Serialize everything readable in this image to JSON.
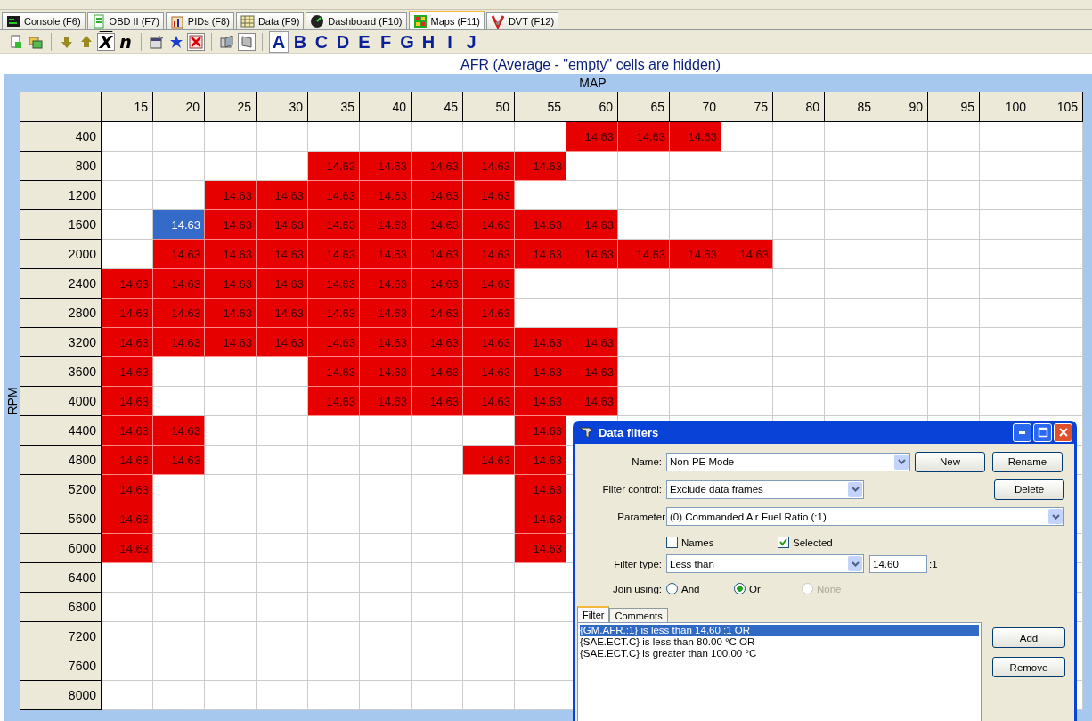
{
  "tabs": [
    {
      "label": "Console (F6)",
      "selected": false
    },
    {
      "label": "OBD II (F7)",
      "selected": false
    },
    {
      "label": "PIDs (F8)",
      "selected": false
    },
    {
      "label": "Data (F9)",
      "selected": false
    },
    {
      "label": "Dashboard (F10)",
      "selected": false
    },
    {
      "label": "Maps (F11)",
      "selected": true
    },
    {
      "label": "DVT (F12)",
      "selected": false
    }
  ],
  "toolbar": {
    "glyph_buttons": [
      {
        "label": "X",
        "pressed": true
      },
      {
        "label": "n",
        "pressed": false
      }
    ],
    "letters": [
      {
        "label": "A",
        "selected": true
      },
      {
        "label": "B",
        "selected": false
      },
      {
        "label": "C",
        "selected": false
      },
      {
        "label": "D",
        "selected": false
      },
      {
        "label": "E",
        "selected": false
      },
      {
        "label": "F",
        "selected": false
      },
      {
        "label": "G",
        "selected": false
      },
      {
        "label": "H",
        "selected": false
      },
      {
        "label": "I",
        "selected": false
      },
      {
        "label": "J",
        "selected": false
      }
    ]
  },
  "map": {
    "title": "AFR (Average - \"empty\" cells are hidden)",
    "x_axis": "MAP",
    "y_axis": "RPM",
    "columns": [
      "15",
      "20",
      "25",
      "30",
      "35",
      "40",
      "45",
      "50",
      "55",
      "60",
      "65",
      "70",
      "75",
      "80",
      "85",
      "90",
      "95",
      "100",
      "105"
    ],
    "rows": [
      {
        "label": "400",
        "cells": [
          null,
          null,
          null,
          null,
          null,
          null,
          null,
          null,
          null,
          {
            "value": "14.63",
            "selected": false
          },
          {
            "value": "14.63",
            "selected": false
          },
          {
            "value": "14.63",
            "selected": false
          }
        ]
      },
      {
        "label": "800",
        "cells": [
          null,
          null,
          null,
          null,
          {
            "value": "14.63",
            "selected": false
          },
          {
            "value": "14.63",
            "selected": false
          },
          {
            "value": "14.63",
            "selected": false
          },
          {
            "value": "14.63",
            "selected": false
          },
          {
            "value": "14.63",
            "selected": false
          }
        ]
      },
      {
        "label": "1200",
        "cells": [
          null,
          null,
          {
            "value": "14.63",
            "selected": false
          },
          {
            "value": "14.63",
            "selected": false
          },
          {
            "value": "14.63",
            "selected": false
          },
          {
            "value": "14.63",
            "selected": false
          },
          {
            "value": "14.63",
            "selected": false
          },
          {
            "value": "14.63",
            "selected": false
          }
        ]
      },
      {
        "label": "1600",
        "cells": [
          null,
          {
            "value": "14.63",
            "selected": true
          },
          {
            "value": "14.63",
            "selected": false
          },
          {
            "value": "14.63",
            "selected": false
          },
          {
            "value": "14.63",
            "selected": false
          },
          {
            "value": "14.63",
            "selected": false
          },
          {
            "value": "14.63",
            "selected": false
          },
          {
            "value": "14.63",
            "selected": false
          },
          {
            "value": "14.63",
            "selected": false
          },
          {
            "value": "14.63",
            "selected": false
          }
        ]
      },
      {
        "label": "2000",
        "cells": [
          null,
          {
            "value": "14.63",
            "selected": false
          },
          {
            "value": "14.63",
            "selected": false
          },
          {
            "value": "14.63",
            "selected": false
          },
          {
            "value": "14.63",
            "selected": false
          },
          {
            "value": "14.63",
            "selected": false
          },
          {
            "value": "14.63",
            "selected": false
          },
          {
            "value": "14.63",
            "selected": false
          },
          {
            "value": "14.63",
            "selected": false
          },
          {
            "value": "14.63",
            "selected": false
          },
          {
            "value": "14.63",
            "selected": false
          },
          {
            "value": "14.63",
            "selected": false
          },
          {
            "value": "14.63",
            "selected": false
          }
        ]
      },
      {
        "label": "2400",
        "cells": [
          {
            "value": "14.63",
            "selected": false
          },
          {
            "value": "14.63",
            "selected": false
          },
          {
            "value": "14.63",
            "selected": false
          },
          {
            "value": "14.63",
            "selected": false
          },
          {
            "value": "14.63",
            "selected": false
          },
          {
            "value": "14.63",
            "selected": false
          },
          {
            "value": "14.63",
            "selected": false
          },
          {
            "value": "14.63",
            "selected": false
          }
        ]
      },
      {
        "label": "2800",
        "cells": [
          {
            "value": "14.63",
            "selected": false
          },
          {
            "value": "14.63",
            "selected": false
          },
          {
            "value": "14.63",
            "selected": false
          },
          {
            "value": "14.63",
            "selected": false
          },
          {
            "value": "14.63",
            "selected": false
          },
          {
            "value": "14.63",
            "selected": false
          },
          {
            "value": "14.63",
            "selected": false
          },
          {
            "value": "14.63",
            "selected": false
          }
        ]
      },
      {
        "label": "3200",
        "cells": [
          {
            "value": "14.63",
            "selected": false
          },
          {
            "value": "14.63",
            "selected": false
          },
          {
            "value": "14.63",
            "selected": false
          },
          {
            "value": "14.63",
            "selected": false
          },
          {
            "value": "14.63",
            "selected": false
          },
          {
            "value": "14.63",
            "selected": false
          },
          {
            "value": "14.63",
            "selected": false
          },
          {
            "value": "14.63",
            "selected": false
          },
          {
            "value": "14.63",
            "selected": false
          },
          {
            "value": "14.63",
            "selected": false
          }
        ]
      },
      {
        "label": "3600",
        "cells": [
          {
            "value": "14.63",
            "selected": false
          },
          null,
          null,
          null,
          {
            "value": "14.63",
            "selected": false
          },
          {
            "value": "14.63",
            "selected": false
          },
          {
            "value": "14.63",
            "selected": false
          },
          {
            "value": "14.63",
            "selected": false
          },
          {
            "value": "14.63",
            "selected": false
          },
          {
            "value": "14.63",
            "selected": false
          }
        ]
      },
      {
        "label": "4000",
        "cells": [
          {
            "value": "14.63",
            "selected": false
          },
          null,
          null,
          null,
          {
            "value": "14.63",
            "selected": false
          },
          {
            "value": "14.63",
            "selected": false
          },
          {
            "value": "14.63",
            "selected": false
          },
          {
            "value": "14.63",
            "selected": false
          },
          {
            "value": "14.63",
            "selected": false
          },
          {
            "value": "14.63",
            "selected": false
          }
        ]
      },
      {
        "label": "4400",
        "cells": [
          {
            "value": "14.63",
            "selected": false
          },
          {
            "value": "14.63",
            "selected": false
          },
          null,
          null,
          null,
          null,
          null,
          null,
          {
            "value": "14.63",
            "selected": false
          }
        ]
      },
      {
        "label": "4800",
        "cells": [
          {
            "value": "14.63",
            "selected": false
          },
          {
            "value": "14.63",
            "selected": false
          },
          null,
          null,
          null,
          null,
          null,
          {
            "value": "14.63",
            "selected": false
          },
          {
            "value": "14.63",
            "selected": false
          }
        ]
      },
      {
        "label": "5200",
        "cells": [
          {
            "value": "14.63",
            "selected": false
          },
          null,
          null,
          null,
          null,
          null,
          null,
          null,
          {
            "value": "14.63",
            "selected": false
          }
        ]
      },
      {
        "label": "5600",
        "cells": [
          {
            "value": "14.63",
            "selected": false
          },
          null,
          null,
          null,
          null,
          null,
          null,
          null,
          {
            "value": "14.63",
            "selected": false
          }
        ]
      },
      {
        "label": "6000",
        "cells": [
          {
            "value": "14.63",
            "selected": false
          },
          null,
          null,
          null,
          null,
          null,
          null,
          null,
          {
            "value": "14.63",
            "selected": false
          }
        ]
      },
      {
        "label": "6400",
        "cells": []
      },
      {
        "label": "6800",
        "cells": []
      },
      {
        "label": "7200",
        "cells": []
      },
      {
        "label": "7600",
        "cells": []
      },
      {
        "label": "8000",
        "cells": []
      }
    ]
  },
  "dialog": {
    "title": "Data filters",
    "name": {
      "label": "Name:",
      "value": "Non-PE Mode"
    },
    "filter_control": {
      "label": "Filter control:",
      "value": "Exclude data frames"
    },
    "parameter": {
      "label": "Parameter",
      "value": "(0) Commanded Air Fuel Ratio (:1)"
    },
    "checkboxes": [
      {
        "label": "Names",
        "checked": false
      },
      {
        "label": "Selected",
        "checked": true
      }
    ],
    "filter_type": {
      "label": "Filter type:",
      "value": "Less than",
      "amount": "14.60",
      "unit": ":1"
    },
    "join": {
      "label": "Join using:",
      "options": [
        {
          "label": "And",
          "selected": false,
          "disabled": false
        },
        {
          "label": "Or",
          "selected": true,
          "disabled": false
        },
        {
          "label": "None",
          "selected": false,
          "disabled": true
        }
      ]
    },
    "tabs": [
      {
        "label": "Filter",
        "selected": true
      },
      {
        "label": "Comments",
        "selected": false
      }
    ],
    "filters": [
      {
        "text": "{GM.AFR.:1} is less than 14.60 :1 OR",
        "selected": true
      },
      {
        "text": "{SAE.ECT.C} is less than 80.00 °C OR",
        "selected": false
      },
      {
        "text": "{SAE.ECT.C} is greater than 100.00 °C",
        "selected": false
      }
    ],
    "buttons": {
      "new": "New",
      "rename": "Rename",
      "delete": "Delete",
      "add": "Add",
      "remove": "Remove"
    }
  }
}
